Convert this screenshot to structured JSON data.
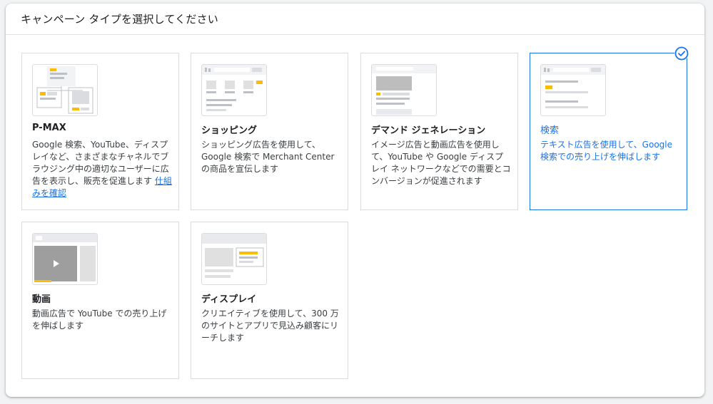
{
  "header": {
    "title": "キャンペーン タイプを選択してください"
  },
  "cards": [
    {
      "key": "pmax",
      "title": "P-MAX",
      "description": "Google 検索、YouTube、ディスプレイなど、さまざまなチャネルでブラウジング中の適切なユーザーに広告を表示し、販売を促進します",
      "link": "仕組みを確認",
      "selected": false
    },
    {
      "key": "shopping",
      "title": "ショッピング",
      "description": "ショッピング広告を使用して、Google 検索で Merchant Center の商品を宣伝します",
      "selected": false
    },
    {
      "key": "demand_gen",
      "title": "デマンド ジェネレーション",
      "description": "イメージ広告と動画広告を使用して、YouTube や Google ディスプレイ ネットワークなどでの需要とコンバージョンが促進されます",
      "selected": false
    },
    {
      "key": "search",
      "title": "検索",
      "description": "テキスト広告を使用して、Google 検索での売り上げを伸ばします",
      "selected": true
    },
    {
      "key": "video",
      "title": "動画",
      "description": "動画広告で YouTube での売り上げを伸ばします",
      "selected": false
    },
    {
      "key": "display",
      "title": "ディスプレイ",
      "description": "クリエイティブを使用して、300 万のサイトとアプリで見込み顧客にリーチします",
      "selected": false
    }
  ],
  "icons": {
    "selected": "check-circle-icon",
    "play": "play-icon"
  },
  "colors": {
    "accent": "#1a73e8",
    "highlight": "#fbbc04",
    "placeholder": "#dadce0"
  }
}
